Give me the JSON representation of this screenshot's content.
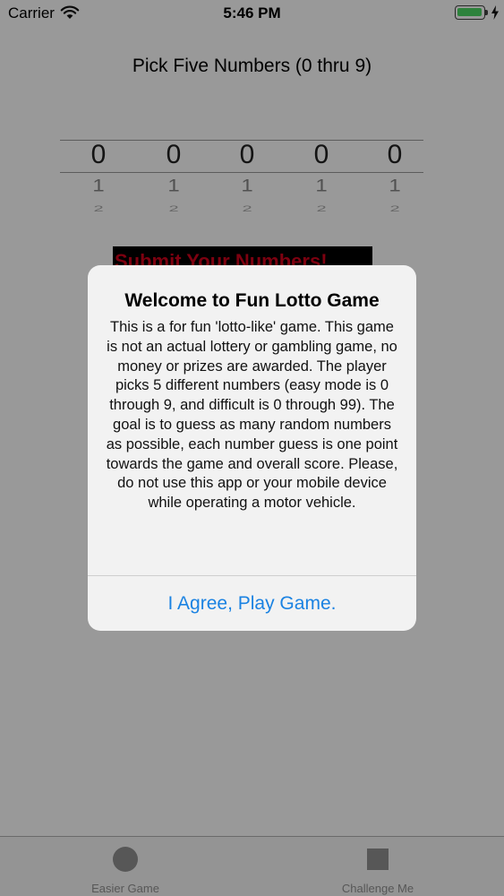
{
  "status_bar": {
    "carrier": "Carrier",
    "time": "5:46 PM"
  },
  "page_title": "Pick Five Numbers (0 thru 9)",
  "pickers": [
    {
      "selected": "0",
      "next1": "1",
      "next2": "2"
    },
    {
      "selected": "0",
      "next1": "1",
      "next2": "2"
    },
    {
      "selected": "0",
      "next1": "1",
      "next2": "2"
    },
    {
      "selected": "0",
      "next1": "1",
      "next2": "2"
    },
    {
      "selected": "0",
      "next1": "1",
      "next2": "2"
    }
  ],
  "submit_label": "Submit Your Numbers!",
  "alert": {
    "title": "Welcome to Fun Lotto Game",
    "message": "This is a for fun 'lotto-like' game. This game is not an actual lottery or gambling game, no money or prizes are awarded. The player picks 5 different numbers (easy mode is 0 through 9, and difficult is 0 through 99). The goal is to guess as many random numbers as possible, each number guess is one point towards the game and overall score. Please, do not use this app or your mobile device while operating a motor vehicle.",
    "button": "I Agree, Play Game."
  },
  "tabs": [
    {
      "label": "Easier Game",
      "icon": "circle-icon"
    },
    {
      "label": "Challenge Me",
      "icon": "square-icon"
    }
  ],
  "colors": {
    "accent": "#1a82e2",
    "submit_text": "#d0021b",
    "battery": "#4cd964"
  }
}
